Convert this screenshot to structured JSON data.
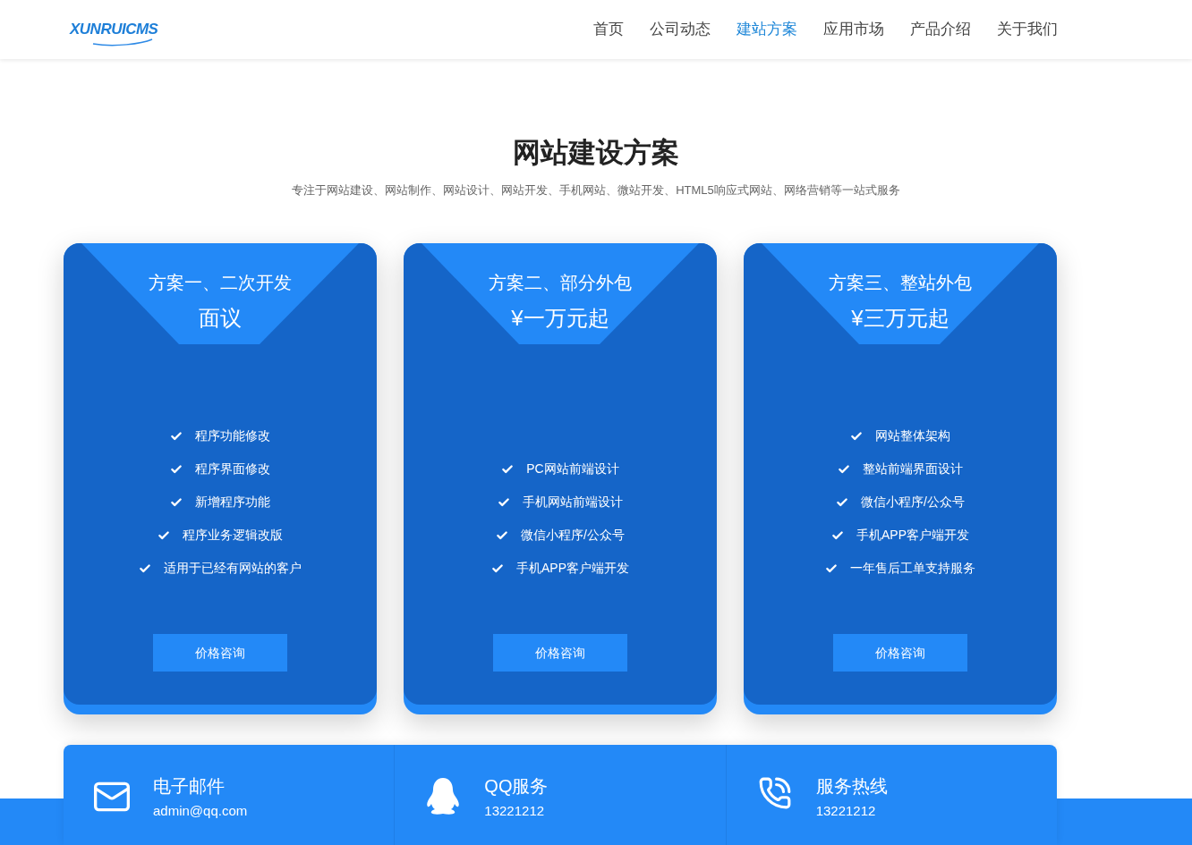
{
  "header": {
    "logo": "XUNRUICMS",
    "nav": [
      {
        "label": "首页",
        "selected": false
      },
      {
        "label": "公司动态",
        "selected": false
      },
      {
        "label": "建站方案",
        "selected": true
      },
      {
        "label": "应用市场",
        "selected": false
      },
      {
        "label": "产品介绍",
        "selected": false
      },
      {
        "label": "关于我们",
        "selected": false
      }
    ]
  },
  "section": {
    "title": "网站建设方案",
    "subtitle": "专注于网站建设、网站制作、网站设计、网站开发、手机网站、微站开发、HTML5响应式网站、网络营销等一站式服务"
  },
  "plans": [
    {
      "name": "方案一、二次开发",
      "price": "面议",
      "features": [
        "程序功能修改",
        "程序界面修改",
        "新增程序功能",
        "程序业务逻辑改版",
        "适用于已经有网站的客户"
      ],
      "button": "价格咨询"
    },
    {
      "name": "方案二、部分外包",
      "price": "¥一万元起",
      "features": [
        "PC网站前端设计",
        "手机网站前端设计",
        "微信小程序/公众号",
        "手机APP客户端开发"
      ],
      "button": "价格咨询"
    },
    {
      "name": "方案三、整站外包",
      "price": "¥三万元起",
      "features": [
        "网站整体架构",
        "整站前端界面设计",
        "微信小程序/公众号",
        "手机APP客户端开发",
        "一年售后工单支持服务"
      ],
      "button": "价格咨询"
    }
  ],
  "contacts": [
    {
      "kind": "email",
      "title": "电子邮件",
      "value": "admin@qq.com"
    },
    {
      "kind": "qq",
      "title": "QQ服务",
      "value": "13221212"
    },
    {
      "kind": "phone",
      "title": "服务热线",
      "value": "13221212"
    }
  ]
}
